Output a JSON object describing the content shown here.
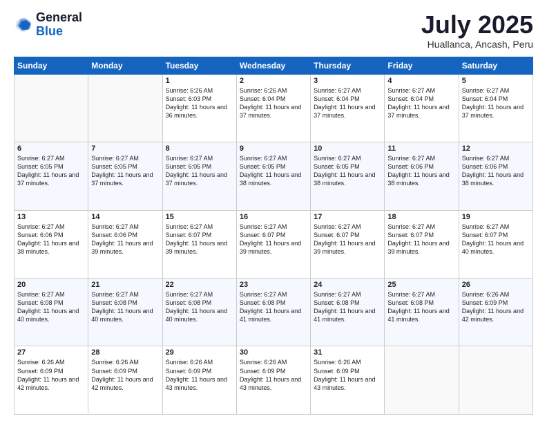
{
  "logo": {
    "general": "General",
    "blue": "Blue"
  },
  "header": {
    "month": "July 2025",
    "location": "Huallanca, Ancash, Peru"
  },
  "weekdays": [
    "Sunday",
    "Monday",
    "Tuesday",
    "Wednesday",
    "Thursday",
    "Friday",
    "Saturday"
  ],
  "weeks": [
    [
      {
        "day": "",
        "info": ""
      },
      {
        "day": "",
        "info": ""
      },
      {
        "day": "1",
        "info": "Sunrise: 6:26 AM\nSunset: 6:03 PM\nDaylight: 11 hours and 36 minutes."
      },
      {
        "day": "2",
        "info": "Sunrise: 6:26 AM\nSunset: 6:04 PM\nDaylight: 11 hours and 37 minutes."
      },
      {
        "day": "3",
        "info": "Sunrise: 6:27 AM\nSunset: 6:04 PM\nDaylight: 11 hours and 37 minutes."
      },
      {
        "day": "4",
        "info": "Sunrise: 6:27 AM\nSunset: 6:04 PM\nDaylight: 11 hours and 37 minutes."
      },
      {
        "day": "5",
        "info": "Sunrise: 6:27 AM\nSunset: 6:04 PM\nDaylight: 11 hours and 37 minutes."
      }
    ],
    [
      {
        "day": "6",
        "info": "Sunrise: 6:27 AM\nSunset: 6:05 PM\nDaylight: 11 hours and 37 minutes."
      },
      {
        "day": "7",
        "info": "Sunrise: 6:27 AM\nSunset: 6:05 PM\nDaylight: 11 hours and 37 minutes."
      },
      {
        "day": "8",
        "info": "Sunrise: 6:27 AM\nSunset: 6:05 PM\nDaylight: 11 hours and 37 minutes."
      },
      {
        "day": "9",
        "info": "Sunrise: 6:27 AM\nSunset: 6:05 PM\nDaylight: 11 hours and 38 minutes."
      },
      {
        "day": "10",
        "info": "Sunrise: 6:27 AM\nSunset: 6:05 PM\nDaylight: 11 hours and 38 minutes."
      },
      {
        "day": "11",
        "info": "Sunrise: 6:27 AM\nSunset: 6:06 PM\nDaylight: 11 hours and 38 minutes."
      },
      {
        "day": "12",
        "info": "Sunrise: 6:27 AM\nSunset: 6:06 PM\nDaylight: 11 hours and 38 minutes."
      }
    ],
    [
      {
        "day": "13",
        "info": "Sunrise: 6:27 AM\nSunset: 6:06 PM\nDaylight: 11 hours and 38 minutes."
      },
      {
        "day": "14",
        "info": "Sunrise: 6:27 AM\nSunset: 6:06 PM\nDaylight: 11 hours and 39 minutes."
      },
      {
        "day": "15",
        "info": "Sunrise: 6:27 AM\nSunset: 6:07 PM\nDaylight: 11 hours and 39 minutes."
      },
      {
        "day": "16",
        "info": "Sunrise: 6:27 AM\nSunset: 6:07 PM\nDaylight: 11 hours and 39 minutes."
      },
      {
        "day": "17",
        "info": "Sunrise: 6:27 AM\nSunset: 6:07 PM\nDaylight: 11 hours and 39 minutes."
      },
      {
        "day": "18",
        "info": "Sunrise: 6:27 AM\nSunset: 6:07 PM\nDaylight: 11 hours and 39 minutes."
      },
      {
        "day": "19",
        "info": "Sunrise: 6:27 AM\nSunset: 6:07 PM\nDaylight: 11 hours and 40 minutes."
      }
    ],
    [
      {
        "day": "20",
        "info": "Sunrise: 6:27 AM\nSunset: 6:08 PM\nDaylight: 11 hours and 40 minutes."
      },
      {
        "day": "21",
        "info": "Sunrise: 6:27 AM\nSunset: 6:08 PM\nDaylight: 11 hours and 40 minutes."
      },
      {
        "day": "22",
        "info": "Sunrise: 6:27 AM\nSunset: 6:08 PM\nDaylight: 11 hours and 40 minutes."
      },
      {
        "day": "23",
        "info": "Sunrise: 6:27 AM\nSunset: 6:08 PM\nDaylight: 11 hours and 41 minutes."
      },
      {
        "day": "24",
        "info": "Sunrise: 6:27 AM\nSunset: 6:08 PM\nDaylight: 11 hours and 41 minutes."
      },
      {
        "day": "25",
        "info": "Sunrise: 6:27 AM\nSunset: 6:08 PM\nDaylight: 11 hours and 41 minutes."
      },
      {
        "day": "26",
        "info": "Sunrise: 6:26 AM\nSunset: 6:09 PM\nDaylight: 11 hours and 42 minutes."
      }
    ],
    [
      {
        "day": "27",
        "info": "Sunrise: 6:26 AM\nSunset: 6:09 PM\nDaylight: 11 hours and 42 minutes."
      },
      {
        "day": "28",
        "info": "Sunrise: 6:26 AM\nSunset: 6:09 PM\nDaylight: 11 hours and 42 minutes."
      },
      {
        "day": "29",
        "info": "Sunrise: 6:26 AM\nSunset: 6:09 PM\nDaylight: 11 hours and 43 minutes."
      },
      {
        "day": "30",
        "info": "Sunrise: 6:26 AM\nSunset: 6:09 PM\nDaylight: 11 hours and 43 minutes."
      },
      {
        "day": "31",
        "info": "Sunrise: 6:26 AM\nSunset: 6:09 PM\nDaylight: 11 hours and 43 minutes."
      },
      {
        "day": "",
        "info": ""
      },
      {
        "day": "",
        "info": ""
      }
    ]
  ]
}
